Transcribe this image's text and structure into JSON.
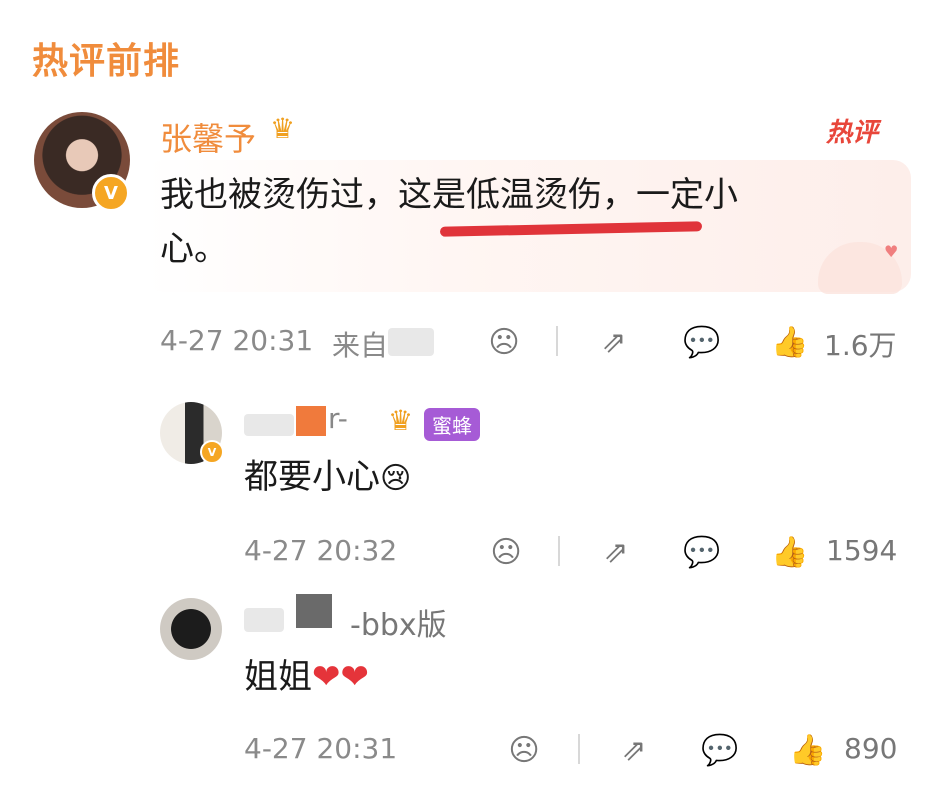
{
  "section_title": "热评前排",
  "main_comment": {
    "username": "张馨予",
    "hot_tag": "热评",
    "text_part1": "我也被烫伤过，",
    "text_highlight": "这是低温烫伤，",
    "text_part2": "一定小",
    "text_line2": "心。",
    "time": "4-27 20:31",
    "source_prefix": "来自",
    "like_count": "1.6万"
  },
  "replies": [
    {
      "username_visible": "r-",
      "badge": "蜜蜂",
      "text": "都要小心",
      "time": "4-27 20:32",
      "like_count": "1594"
    },
    {
      "username_visible": "-bbx版",
      "text": "姐姐",
      "time": "4-27 20:31",
      "like_count": "890"
    }
  ],
  "colors": {
    "accent_orange": "#f08c3c",
    "underline_red": "#e0343a",
    "badge_purple": "#a65bd6",
    "verified_gold": "#f5a623"
  },
  "icons": [
    "crown-icon",
    "verified-icon",
    "dislike-icon",
    "share-icon",
    "comment-icon",
    "like-icon",
    "heart-icon",
    "crying-emoji-icon"
  ]
}
